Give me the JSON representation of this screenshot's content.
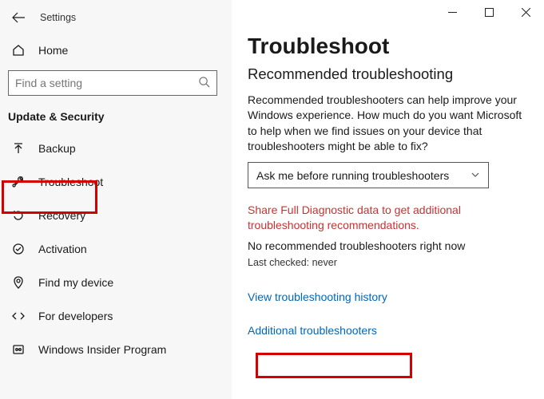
{
  "header": {
    "app_title": "Settings"
  },
  "sidebar": {
    "home_label": "Home",
    "search_placeholder": "Find a setting",
    "section_title": "Update & Security",
    "items": [
      {
        "label": "Backup"
      },
      {
        "label": "Troubleshoot"
      },
      {
        "label": "Recovery"
      },
      {
        "label": "Activation"
      },
      {
        "label": "Find my device"
      },
      {
        "label": "For developers"
      },
      {
        "label": "Windows Insider Program"
      }
    ]
  },
  "main": {
    "title": "Troubleshoot",
    "subtitle": "Recommended troubleshooting",
    "description": "Recommended troubleshooters can help improve your Windows experience. How much do you want Microsoft to help when we find issues on your device that troubleshooters might be able to fix?",
    "dropdown_value": "Ask me before running troubleshooters",
    "error_text": "Share Full Diagnostic data to get additional troubleshooting recommendations.",
    "status_text": "No recommended troubleshooters right now",
    "last_checked": "Last checked: never",
    "link_history": "View troubleshooting history",
    "link_additional": "Additional troubleshooters"
  }
}
